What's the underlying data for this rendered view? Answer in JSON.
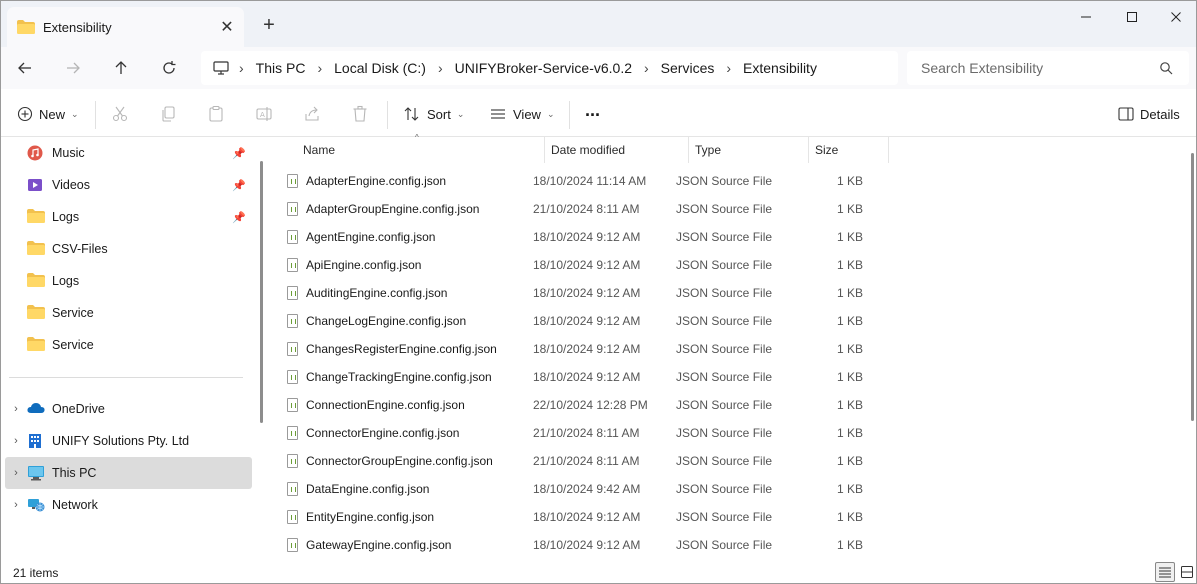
{
  "tab": {
    "title": "Extensibility"
  },
  "breadcrumb": [
    "This PC",
    "Local Disk (C:)",
    "UNIFYBroker-Service-v6.0.2",
    "Services",
    "Extensibility"
  ],
  "search": {
    "placeholder": "Search Extensibility"
  },
  "commandbar": {
    "new": "New",
    "sort": "Sort",
    "view": "View",
    "more": "...",
    "details": "Details"
  },
  "sidebar": {
    "quick_access": [
      {
        "label": "Music",
        "icon": "music-icon",
        "pinned": true
      },
      {
        "label": "Videos",
        "icon": "videos-icon",
        "pinned": true
      },
      {
        "label": "Logs",
        "icon": "folder-icon",
        "pinned": true
      },
      {
        "label": "CSV-Files",
        "icon": "folder-icon",
        "pinned": false
      },
      {
        "label": "Logs",
        "icon": "folder-icon",
        "pinned": false
      },
      {
        "label": "Service",
        "icon": "folder-icon",
        "pinned": false
      },
      {
        "label": "Service",
        "icon": "folder-icon",
        "pinned": false
      }
    ],
    "locations": [
      {
        "label": "OneDrive",
        "icon": "onedrive-icon",
        "selected": false
      },
      {
        "label": "UNIFY Solutions Pty. Ltd",
        "icon": "building-icon",
        "selected": false
      },
      {
        "label": "This PC",
        "icon": "monitor-icon",
        "selected": true
      },
      {
        "label": "Network",
        "icon": "network-icon",
        "selected": false
      }
    ]
  },
  "columns": {
    "name": "Name",
    "date": "Date modified",
    "type": "Type",
    "size": "Size"
  },
  "files": [
    {
      "name": "AdapterEngine.config.json",
      "date": "18/10/2024 11:14 AM",
      "type": "JSON Source File",
      "size": "1 KB"
    },
    {
      "name": "AdapterGroupEngine.config.json",
      "date": "21/10/2024 8:11 AM",
      "type": "JSON Source File",
      "size": "1 KB"
    },
    {
      "name": "AgentEngine.config.json",
      "date": "18/10/2024 9:12 AM",
      "type": "JSON Source File",
      "size": "1 KB"
    },
    {
      "name": "ApiEngine.config.json",
      "date": "18/10/2024 9:12 AM",
      "type": "JSON Source File",
      "size": "1 KB"
    },
    {
      "name": "AuditingEngine.config.json",
      "date": "18/10/2024 9:12 AM",
      "type": "JSON Source File",
      "size": "1 KB"
    },
    {
      "name": "ChangeLogEngine.config.json",
      "date": "18/10/2024 9:12 AM",
      "type": "JSON Source File",
      "size": "1 KB"
    },
    {
      "name": "ChangesRegisterEngine.config.json",
      "date": "18/10/2024 9:12 AM",
      "type": "JSON Source File",
      "size": "1 KB"
    },
    {
      "name": "ChangeTrackingEngine.config.json",
      "date": "18/10/2024 9:12 AM",
      "type": "JSON Source File",
      "size": "1 KB"
    },
    {
      "name": "ConnectionEngine.config.json",
      "date": "22/10/2024 12:28 PM",
      "type": "JSON Source File",
      "size": "1 KB"
    },
    {
      "name": "ConnectorEngine.config.json",
      "date": "21/10/2024 8:11 AM",
      "type": "JSON Source File",
      "size": "1 KB"
    },
    {
      "name": "ConnectorGroupEngine.config.json",
      "date": "21/10/2024 8:11 AM",
      "type": "JSON Source File",
      "size": "1 KB"
    },
    {
      "name": "DataEngine.config.json",
      "date": "18/10/2024 9:42 AM",
      "type": "JSON Source File",
      "size": "1 KB"
    },
    {
      "name": "EntityEngine.config.json",
      "date": "18/10/2024 9:12 AM",
      "type": "JSON Source File",
      "size": "1 KB"
    },
    {
      "name": "GatewayEngine.config.json",
      "date": "18/10/2024 9:12 AM",
      "type": "JSON Source File",
      "size": "1 KB"
    }
  ],
  "status": {
    "item_count": "21 items"
  },
  "colors": {
    "folder": "#f2c14e",
    "accent": "#0067c0",
    "selected": "#dcdcdc"
  }
}
